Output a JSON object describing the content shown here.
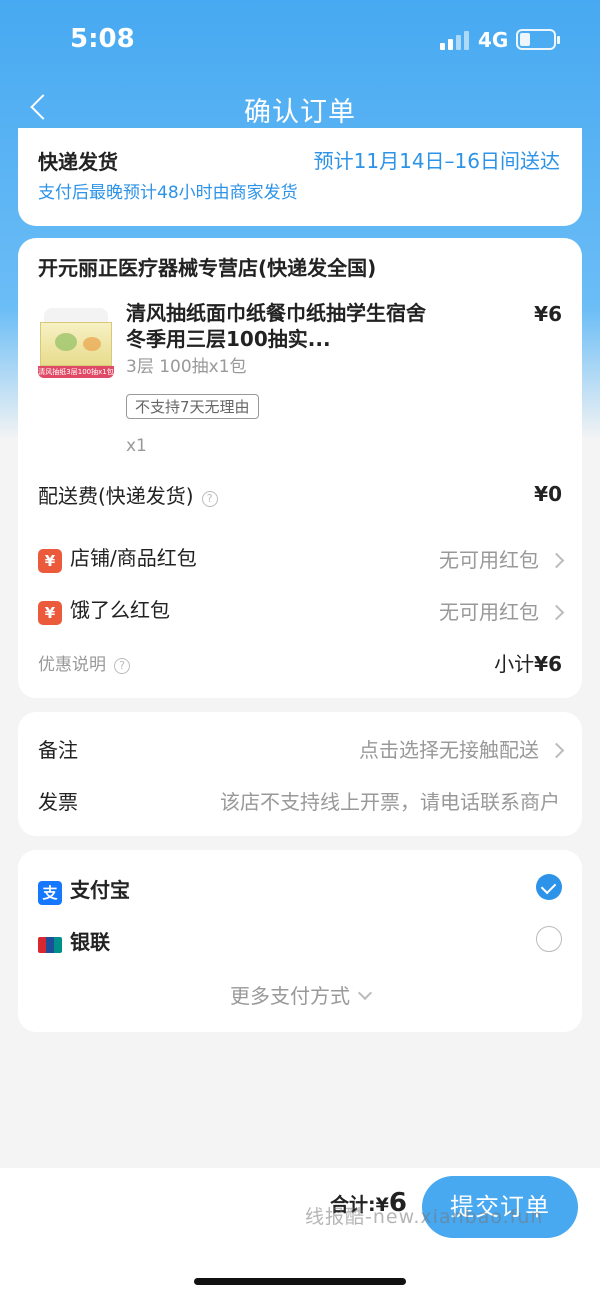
{
  "status_bar": {
    "time": "5:08",
    "network": "4G"
  },
  "nav": {
    "title": "确认订单"
  },
  "delivery": {
    "label": "快递发货",
    "eta": "预计11月14日–16日间送达",
    "note": "支付后最晚预计48小时由商家发货"
  },
  "shop": {
    "name": "开元丽正医疗器械专营店(快递发全国)",
    "product": {
      "title": "清风抽纸面巾纸餐巾纸抽学生宿舍冬季用三层100抽实...",
      "price": "¥6",
      "spec": "3层 100抽x1包",
      "badge": "不支持7天无理由",
      "quantity": "x1",
      "image_tag": "清风抽纸3层100抽x1包"
    },
    "shipping": {
      "label": "配送费(快递发货)",
      "value": "¥0",
      "help": "?"
    },
    "coupons": [
      {
        "icon": "¥",
        "label": "店铺/商品红包",
        "value": "无可用红包"
      },
      {
        "icon": "¥",
        "label": "饿了么红包",
        "value": "无可用红包"
      }
    ],
    "discount_note": {
      "label": "优惠说明",
      "help": "?"
    },
    "subtotal": {
      "label": "小计",
      "value": "¥6"
    }
  },
  "extras": {
    "remark": {
      "label": "备注",
      "value": "点击选择无接触配送"
    },
    "invoice": {
      "label": "发票",
      "value": "该店不支持线上开票，请电话联系商户"
    }
  },
  "payment": {
    "methods": [
      {
        "label": "支付宝",
        "icon": "支",
        "selected": true
      },
      {
        "label": "银联",
        "selected": false
      }
    ],
    "more": "更多支付方式"
  },
  "footer": {
    "total_label": "合计:",
    "total_currency": "¥",
    "total_value": "6",
    "submit": "提交订单",
    "watermark": "线报酷-new.xianbao.fun"
  },
  "colors": {
    "accent": "#2c93e8",
    "button": "#48a8f0",
    "coupon_red": "#ec5a3c"
  }
}
